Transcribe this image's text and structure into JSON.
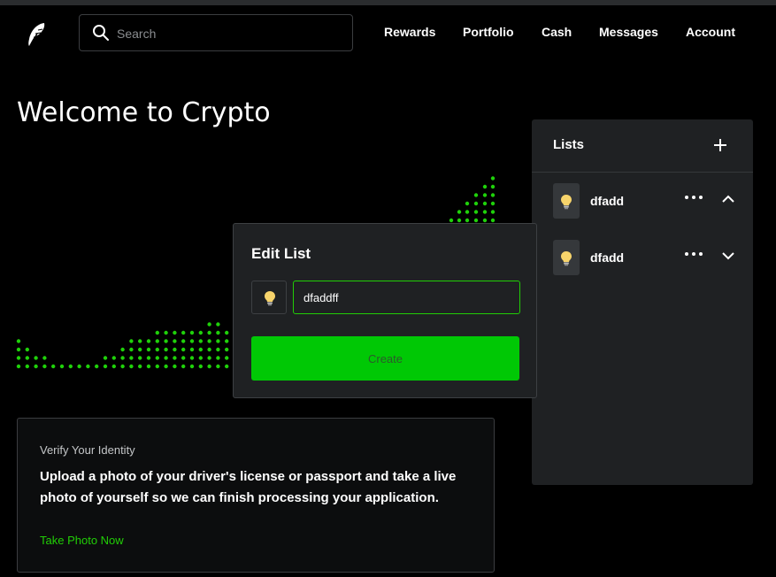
{
  "header": {
    "search_placeholder": "Search",
    "nav": [
      "Rewards",
      "Portfolio",
      "Cash",
      "Messages",
      "Account"
    ]
  },
  "main": {
    "title": "Welcome to Crypto"
  },
  "lists_panel": {
    "title": "Lists",
    "items": [
      {
        "name": "dfadd",
        "icon": "lightbulb-icon",
        "expanded": true
      },
      {
        "name": "dfadd",
        "icon": "lightbulb-icon",
        "expanded": false
      }
    ]
  },
  "edit_list_modal": {
    "title": "Edit List",
    "icon": "lightbulb-icon",
    "name_value": "dfaddff",
    "submit_label": "Create"
  },
  "verify_card": {
    "title": "Verify Your Identity",
    "body": "Upload a photo of your driver's license or passport and take a live photo of yourself so we can finish processing your application.",
    "link": "Take Photo Now"
  },
  "colors": {
    "accent": "#00c805",
    "link": "#21ce06",
    "panel": "#1f2123",
    "background": "#000000"
  }
}
